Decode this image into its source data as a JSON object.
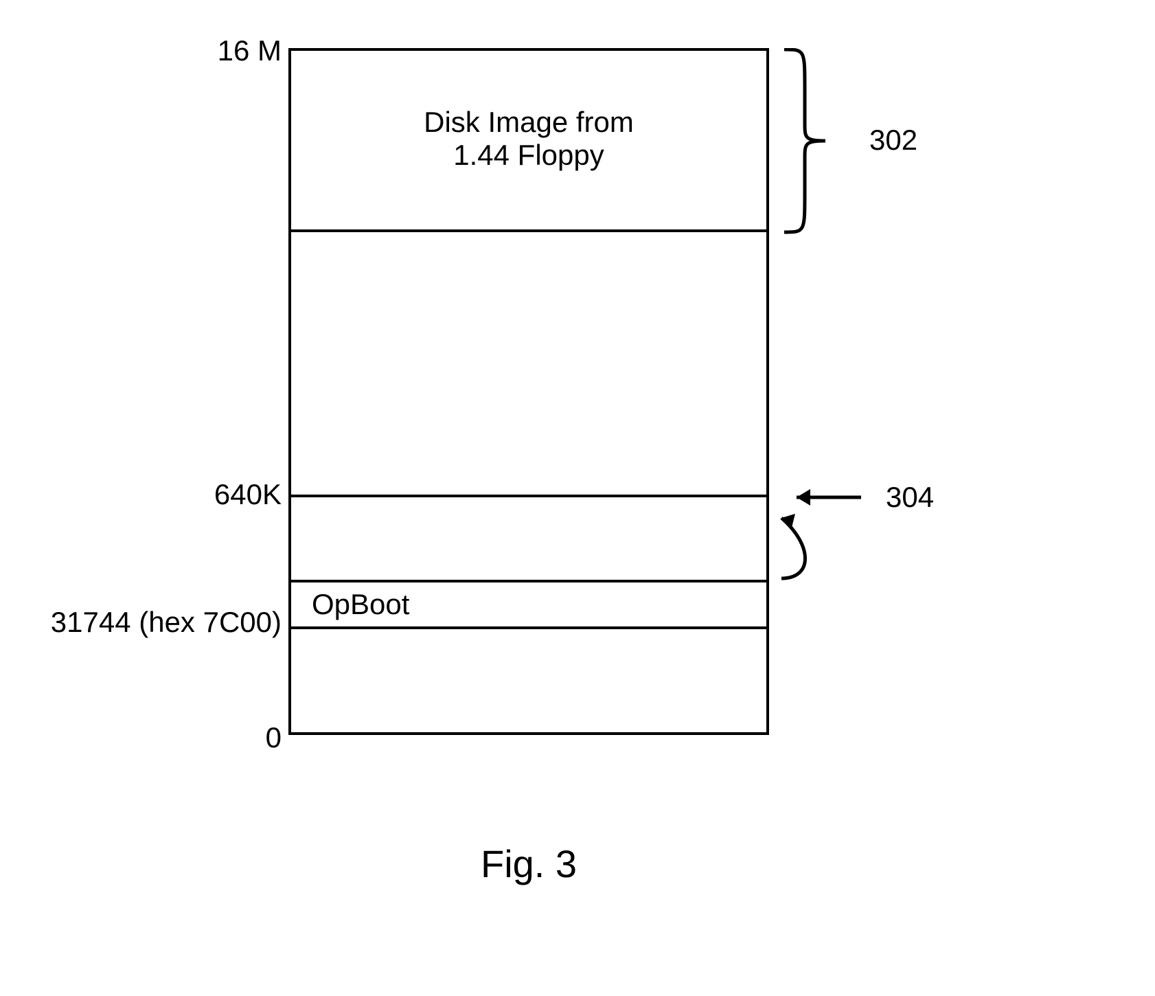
{
  "labels": {
    "top": "16 M",
    "mid1": "640K",
    "mid2": "31744 (hex 7C00)",
    "bottom": "0"
  },
  "regions": {
    "disk_image_line1": "Disk Image from",
    "disk_image_line2": "1.44 Floppy",
    "opboot": "OpBoot"
  },
  "callouts": {
    "top_ref": "302",
    "arrow_ref": "304"
  },
  "caption": "Fig. 3"
}
